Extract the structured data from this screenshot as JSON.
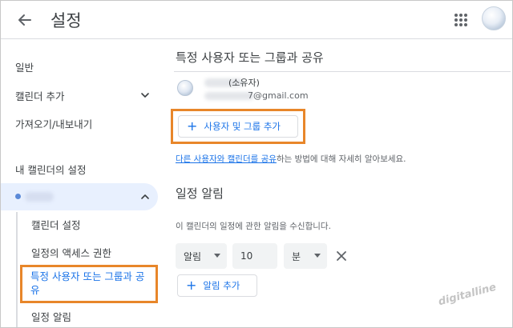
{
  "header": {
    "title": "설정",
    "back_icon": "arrow-left-icon",
    "apps_icon": "apps-grid-icon"
  },
  "sidebar": {
    "general": "일반",
    "add_calendar": "캘린더 추가",
    "import_export": "가져오기/내보내기",
    "my_calendars_heading": "내 캘린더의 설정",
    "sub_items": {
      "calendar_settings": "캘린더 설정",
      "access_permissions": "일정의 액세스 권한",
      "share_with_specific": "특정 사용자 또는 그룹과 공유",
      "event_notifications": "일정 알림"
    }
  },
  "main": {
    "share_section_title": "특정 사용자 또는 그룹과 공유",
    "owner": {
      "role": "(소유자)",
      "email_suffix": "7@gmail.com"
    },
    "add_people_button": "사용자 및 그룹 추가",
    "help": {
      "link1": "다른 사용자와 캘린더를 공유",
      "rest": "하는 방법에 대해 자세히 알아보세요."
    },
    "notifications": {
      "title": "일정 알림",
      "description": "이 캘린더의 일정에 관한 알림을 수신합니다.",
      "type_value": "알림",
      "amount_value": "10",
      "unit_value": "분",
      "add_button": "알림 추가"
    }
  },
  "watermark": "digitalline",
  "colors": {
    "accent": "#1a73e8",
    "highlight_box": "#e8862a",
    "selected_bg": "#e8f0fe"
  }
}
